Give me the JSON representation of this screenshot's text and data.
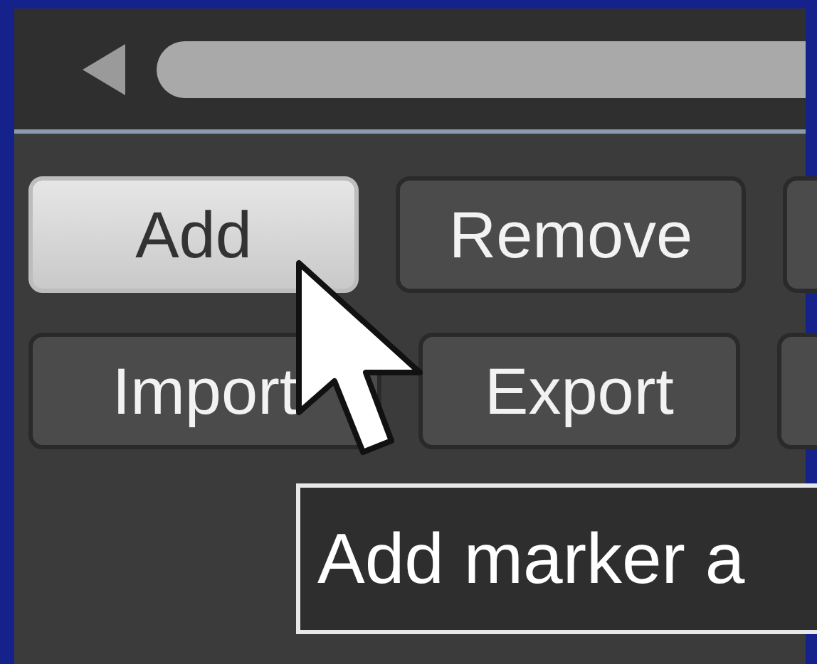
{
  "button_rows": [
    [
      {
        "label": "Add",
        "hovered": true
      },
      {
        "label": "Remove",
        "hovered": false
      },
      {
        "hovered": false
      }
    ],
    [
      {
        "label": "Import",
        "hovered": false
      },
      {
        "label": "Export",
        "hovered": false
      },
      {
        "hovered": false
      }
    ]
  ],
  "tooltip": {
    "text": "Add marker a"
  }
}
